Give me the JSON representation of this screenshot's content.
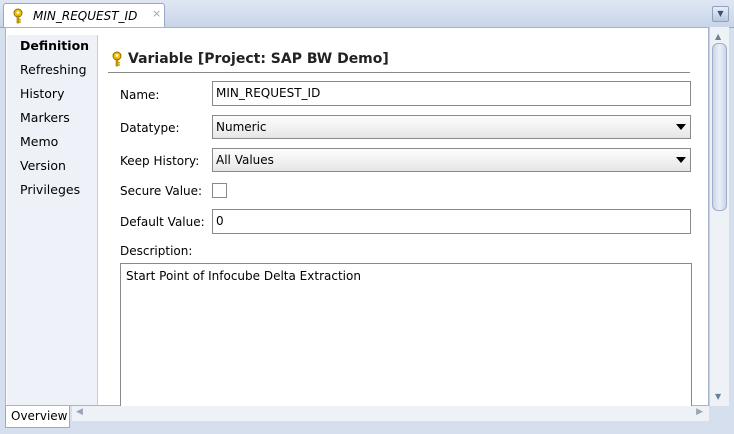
{
  "tab": {
    "title": "MIN_REQUEST_ID",
    "close": "×",
    "icon": "key-icon"
  },
  "view_menu": {
    "icon": "chevron-down-icon",
    "glyph": "▼"
  },
  "sidebar": {
    "items": [
      {
        "label": "Definition",
        "active": true
      },
      {
        "label": "Refreshing"
      },
      {
        "label": "History"
      },
      {
        "label": "Markers"
      },
      {
        "label": "Memo"
      },
      {
        "label": "Version"
      },
      {
        "label": "Privileges"
      }
    ]
  },
  "header": {
    "title": "Variable [Project: SAP BW Demo]",
    "icon": "key-icon"
  },
  "form": {
    "name_label": "Name:",
    "name_value": "MIN_REQUEST_ID",
    "datatype_label": "Datatype:",
    "datatype_value": "Numeric",
    "keep_history_label": "Keep History:",
    "keep_history_value": "All Values",
    "secure_value_label": "Secure Value:",
    "secure_value_checked": false,
    "default_value_label": "Default Value:",
    "default_value_value": "0",
    "description_label": "Description:",
    "description_value": "Start Point of Infocube Delta Extraction"
  },
  "bottom": {
    "overview_tab": "Overview"
  },
  "scroll": {
    "up": "▲",
    "down": "▼",
    "left": "◀",
    "right": "▶"
  },
  "colors": {
    "accent": "#d6dfee",
    "border": "#8a8a8a",
    "nav_bg": "#eef2f8"
  }
}
